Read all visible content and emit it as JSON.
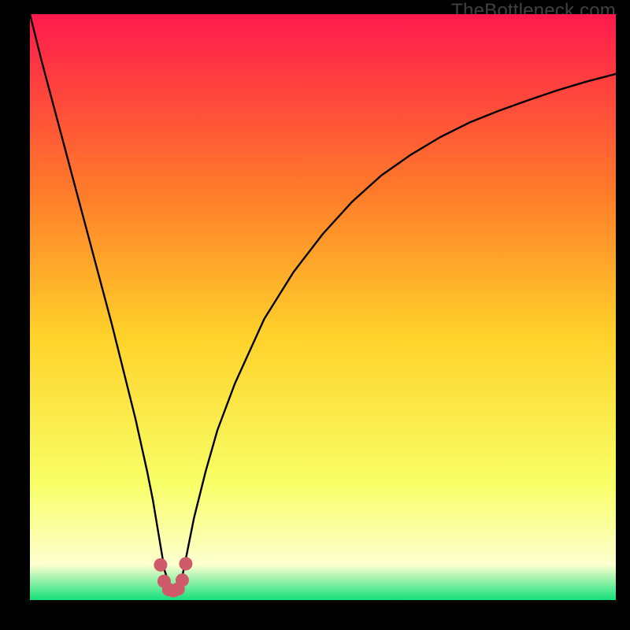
{
  "watermark": "TheBottleneck.com",
  "colors": {
    "bg": "#000000",
    "gradient_top": "#ff1a4d",
    "gradient_mid_upper": "#ff7a2a",
    "gradient_mid": "#ffd22a",
    "gradient_lower": "#f8ff66",
    "gradient_pale": "#fdffcf",
    "gradient_base": "#14e07a",
    "curve": "#000000",
    "marker": "#cf5a6a"
  },
  "chart_data": {
    "type": "line",
    "title": "",
    "xlabel": "",
    "ylabel": "",
    "xlim": [
      0,
      100
    ],
    "ylim": [
      0,
      100
    ],
    "series": [
      {
        "name": "bottleneck-curve",
        "x": [
          0,
          2,
          4,
          6,
          8,
          10,
          12,
          14,
          16,
          18,
          20,
          21,
          22,
          23,
          24,
          25,
          26,
          27,
          28,
          30,
          32,
          35,
          40,
          45,
          50,
          55,
          60,
          65,
          70,
          75,
          80,
          85,
          90,
          95,
          100
        ],
        "y": [
          100,
          92,
          84.5,
          77,
          69.5,
          62,
          54.5,
          47,
          39,
          31,
          22,
          17,
          11,
          5,
          2,
          2,
          4,
          9,
          14,
          22,
          29,
          37,
          48,
          56,
          62.5,
          68,
          72.5,
          76,
          79,
          81.5,
          83.5,
          85.3,
          87,
          88.5,
          89.8
        ]
      }
    ],
    "markers": {
      "name": "highlight-dots",
      "x": [
        22.3,
        22.9,
        23.7,
        24.5,
        25.3,
        26.0,
        26.6
      ],
      "y": [
        6.0,
        3.2,
        1.8,
        1.6,
        1.9,
        3.4,
        6.2
      ]
    }
  }
}
